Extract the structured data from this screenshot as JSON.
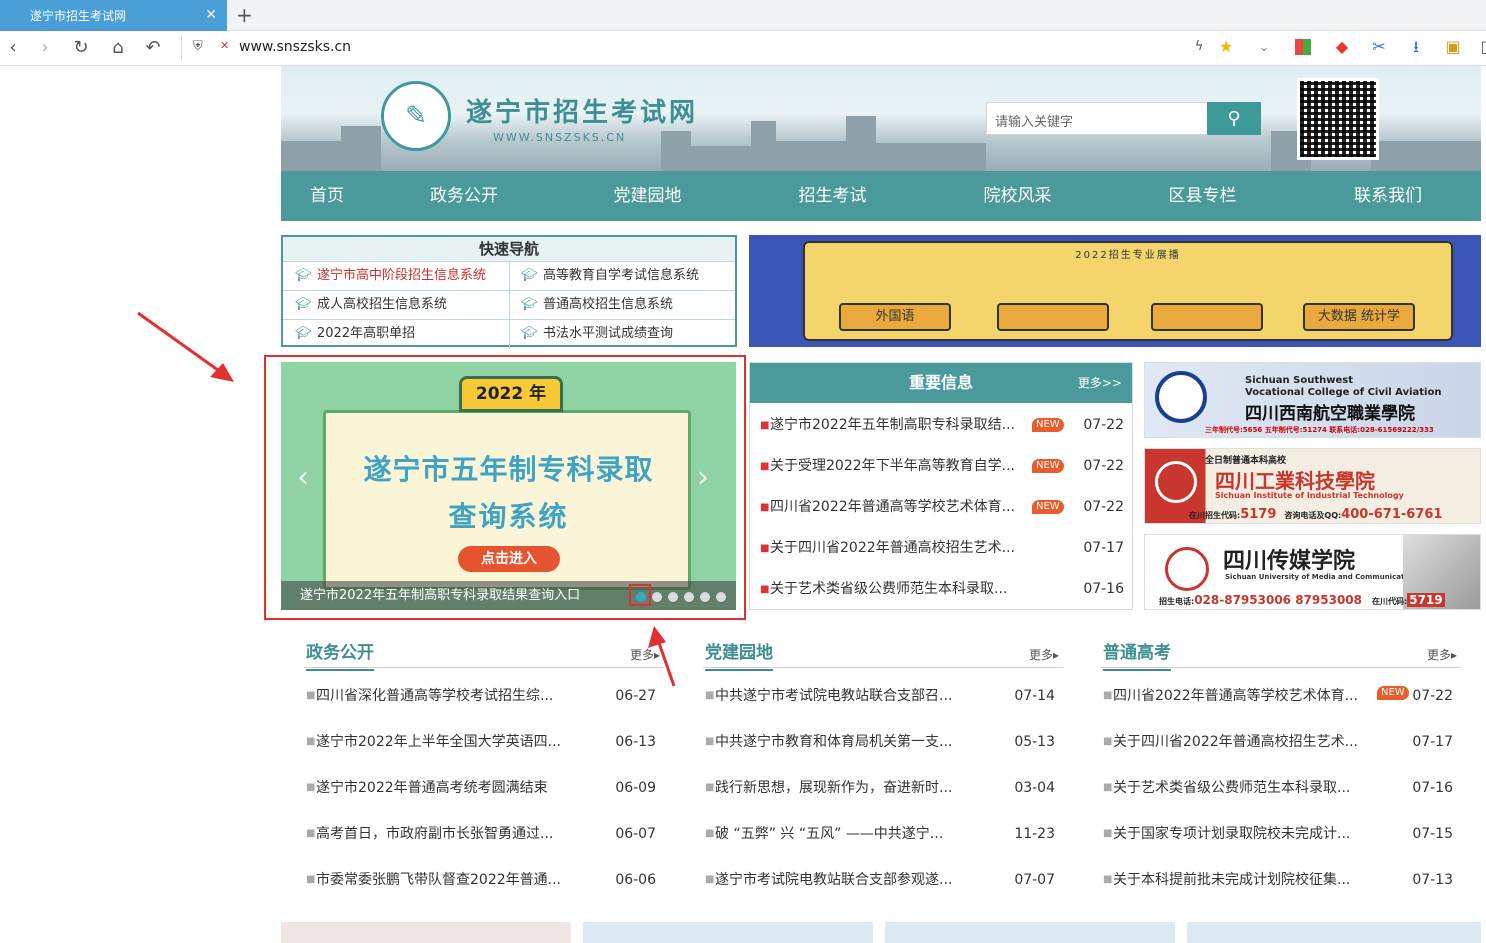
{
  "browser": {
    "tab_title": "遂宁市招生考试网",
    "tab_close": "✕",
    "new_tab": "+",
    "url": "www.snszsks.cn"
  },
  "header": {
    "site_title": "遂宁市招生考试网",
    "site_subtitle": "WWW.SNSZSKS.CN",
    "search_placeholder": "请输入关键字"
  },
  "nav": [
    "首页",
    "政务公开",
    "党建园地",
    "招生考试",
    "院校风采",
    "区县专栏",
    "联系我们"
  ],
  "quick_nav": {
    "title": "快速导航",
    "items": [
      {
        "label": "遂宁市高中阶段招生信息系统",
        "highlight": true
      },
      {
        "label": "高等教育自学考试信息系统",
        "highlight": false
      },
      {
        "label": "成人高校招生信息系统",
        "highlight": false
      },
      {
        "label": "普通高校招生信息系统",
        "highlight": false
      },
      {
        "label": "2022年高职单招",
        "highlight": false
      },
      {
        "label": "书法水平测试成绩查询",
        "highlight": false
      }
    ]
  },
  "promo": {
    "title": "2022招生专业展播",
    "buttons": [
      "外国语",
      "",
      "",
      "大数据  统计学"
    ]
  },
  "slider": {
    "year": "2022 年",
    "line1": "遂宁市五年制专科录取",
    "line2": "查询系统",
    "button": "点击进入",
    "caption": "遂宁市2022年五年制高职专科录取结果查询入口",
    "dots": 6,
    "active_dot": 0
  },
  "important": {
    "title": "重要信息",
    "more": "更多>>",
    "items": [
      {
        "text": "遂宁市2022年五年制高职专科录取结...",
        "new": true,
        "date": "07-22"
      },
      {
        "text": "关于受理2022年下半年高等教育自学...",
        "new": true,
        "date": "07-22"
      },
      {
        "text": "四川省2022年普通高等学校艺术体育...",
        "new": true,
        "date": "07-22"
      },
      {
        "text": "关于四川省2022年普通高校招生艺术...",
        "new": false,
        "date": "07-17"
      },
      {
        "text": "关于艺术类省级公费师范生本科录取...",
        "new": false,
        "date": "07-16"
      }
    ],
    "new_label": "NEW"
  },
  "ads": [
    {
      "en": "Sichuan Southwest",
      "en2": "Vocational College of Civil Aviation",
      "cn": "四川西南航空職業學院",
      "info": "三年制代号:5656  五年制代号:51274  联系电话:028-61569222/333"
    },
    {
      "top": "全日制普通本科高校",
      "cn": "四川工業科技學院",
      "en": "Sichuan Institute of Industrial Technology",
      "code_label": "在川招生代码:",
      "code": "5179",
      "tel_label": "咨询电话及QQ:",
      "tel": "400-671-6761"
    },
    {
      "cn": "四川传媒学院",
      "en": "Sichuan University of Media and Communications",
      "tel_label": "招生电话:",
      "tel": "028-87953006  87953008",
      "code_label": "在川代码:",
      "code": "5719"
    }
  ],
  "columns": [
    {
      "title": "政务公开",
      "more": "更多▸",
      "items": [
        {
          "text": "四川省深化普通高等学校考试招生综...",
          "date": "06-27"
        },
        {
          "text": "遂宁市2022年上半年全国大学英语四...",
          "date": "06-13"
        },
        {
          "text": "遂宁市2022年普通高考统考圆满结束",
          "date": "06-09"
        },
        {
          "text": "高考首日，市政府副市长张智勇通过...",
          "date": "06-07"
        },
        {
          "text": "市委常委张鹏飞带队督查2022年普通...",
          "date": "06-06"
        }
      ]
    },
    {
      "title": "党建园地",
      "more": "更多▸",
      "items": [
        {
          "text": "中共遂宁市考试院电教站联合支部召...",
          "date": "07-14"
        },
        {
          "text": "中共遂宁市教育和体育局机关第一支...",
          "date": "05-13"
        },
        {
          "text": "践行新思想，展现新作为，奋进新时...",
          "date": "03-04"
        },
        {
          "text": "破 “五弊” 兴 “五风” ——中共遂宁...",
          "date": "11-23"
        },
        {
          "text": "遂宁市考试院电教站联合支部参观遂...",
          "date": "07-07"
        }
      ]
    },
    {
      "title": "普通高考",
      "more": "更多▸",
      "items": [
        {
          "text": "四川省2022年普通高等学校艺术体育...",
          "date": "07-22",
          "new": true
        },
        {
          "text": "关于四川省2022年普通高校招生艺术...",
          "date": "07-17"
        },
        {
          "text": "关于艺术类省级公费师范生本科录取...",
          "date": "07-16"
        },
        {
          "text": "关于国家专项计划录取院校未完成计...",
          "date": "07-15"
        },
        {
          "text": "关于本科提前批未完成计划院校征集...",
          "date": "07-13"
        }
      ]
    }
  ],
  "colors": {
    "teal": "#4a9a9c",
    "red_annotation": "#e03030",
    "new_badge": "#e85d2b"
  }
}
